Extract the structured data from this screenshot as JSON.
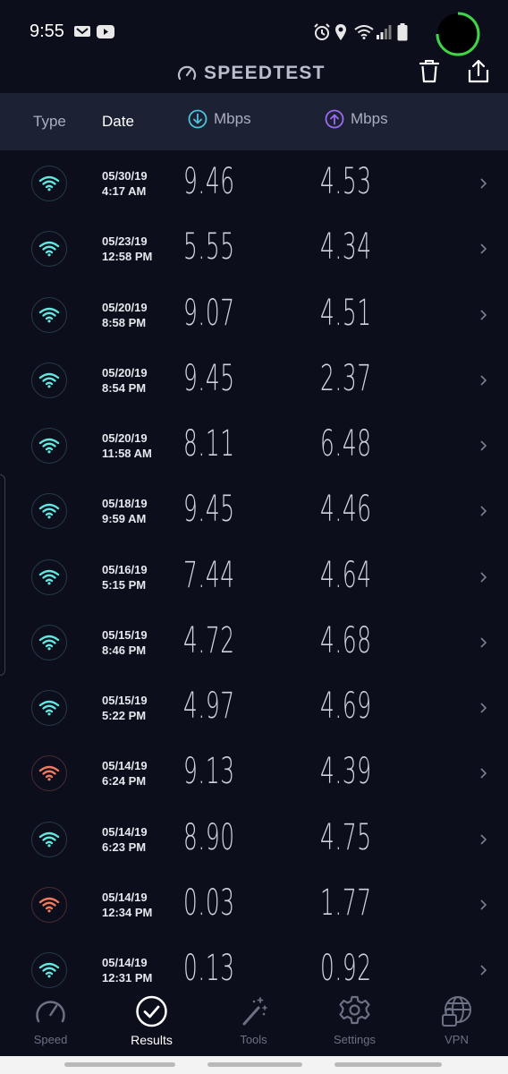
{
  "status_bar": {
    "time": "9:55"
  },
  "header": {
    "title": "SPEEDTEST"
  },
  "columns": {
    "type": "Type",
    "date": "Date",
    "download": "Mbps",
    "upload": "Mbps"
  },
  "colors": {
    "good": "#62e6df",
    "bad": "#f27a5d",
    "upload_accent": "#9b6cf5",
    "download_accent": "#4cc3dc"
  },
  "results": [
    {
      "date": "05/30/19",
      "time": "4:17 AM",
      "download": "9.46",
      "upload": "4.53",
      "status": "good"
    },
    {
      "date": "05/23/19",
      "time": "12:58 PM",
      "download": "5.55",
      "upload": "4.34",
      "status": "good"
    },
    {
      "date": "05/20/19",
      "time": "8:58 PM",
      "download": "9.07",
      "upload": "4.51",
      "status": "good"
    },
    {
      "date": "05/20/19",
      "time": "8:54 PM",
      "download": "9.45",
      "upload": "2.37",
      "status": "good"
    },
    {
      "date": "05/20/19",
      "time": "11:58 AM",
      "download": "8.11",
      "upload": "6.48",
      "status": "good"
    },
    {
      "date": "05/18/19",
      "time": "9:59 AM",
      "download": "9.45",
      "upload": "4.46",
      "status": "good"
    },
    {
      "date": "05/16/19",
      "time": "5:15 PM",
      "download": "7.44",
      "upload": "4.64",
      "status": "good"
    },
    {
      "date": "05/15/19",
      "time": "8:46 PM",
      "download": "4.72",
      "upload": "4.68",
      "status": "good"
    },
    {
      "date": "05/15/19",
      "time": "5:22 PM",
      "download": "4.97",
      "upload": "4.69",
      "status": "good"
    },
    {
      "date": "05/14/19",
      "time": "6:24 PM",
      "download": "9.13",
      "upload": "4.39",
      "status": "bad"
    },
    {
      "date": "05/14/19",
      "time": "6:23 PM",
      "download": "8.90",
      "upload": "4.75",
      "status": "good"
    },
    {
      "date": "05/14/19",
      "time": "12:34 PM",
      "download": "0.03",
      "upload": "1.77",
      "status": "bad"
    },
    {
      "date": "05/14/19",
      "time": "12:31 PM",
      "download": "0.13",
      "upload": "0.92",
      "status": "good"
    }
  ],
  "nav": [
    {
      "id": "speed",
      "label": "Speed",
      "icon": "speedometer-icon"
    },
    {
      "id": "results",
      "label": "Results",
      "icon": "check-circle-icon",
      "active": true
    },
    {
      "id": "tools",
      "label": "Tools",
      "icon": "magic-wand-icon"
    },
    {
      "id": "settings",
      "label": "Settings",
      "icon": "gear-icon"
    },
    {
      "id": "vpn",
      "label": "VPN",
      "icon": "globe-lock-icon"
    }
  ]
}
